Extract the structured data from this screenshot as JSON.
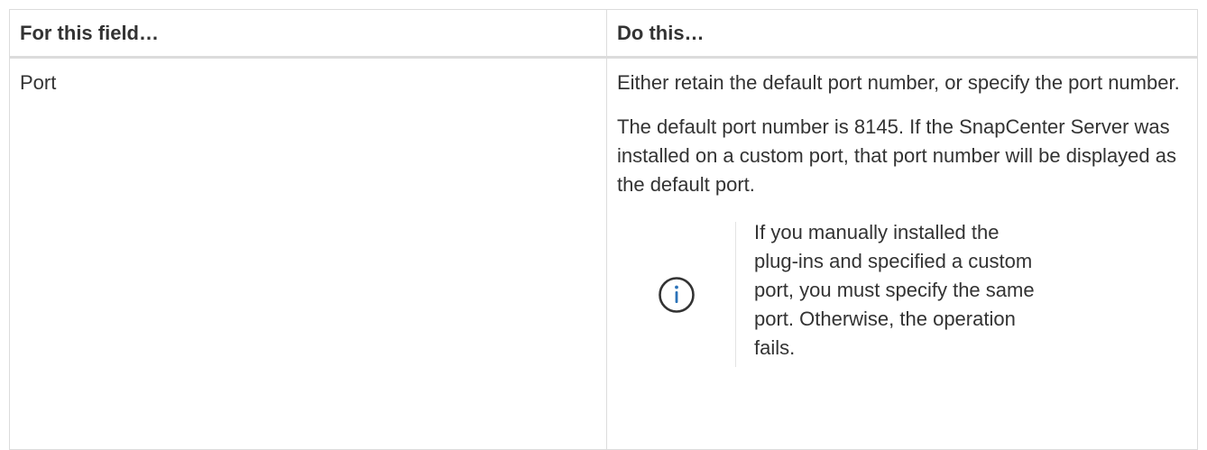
{
  "table": {
    "headers": {
      "field": "For this field…",
      "action": "Do this…"
    },
    "rows": [
      {
        "field": "Port",
        "paragraphs": [
          "Either retain the default port number, or specify the port number.",
          "The default port number is 8145. If the SnapCenter Server was installed on a custom port, that port number will be displayed as the default port."
        ],
        "note": {
          "icon": "info-icon",
          "text": "If you manually installed the plug-ins and specified a custom port, you must specify the same port. Otherwise, the operation fails."
        }
      }
    ]
  },
  "colors": {
    "text": "#333333",
    "border": "#dcdcdc",
    "icon": "#333333"
  }
}
